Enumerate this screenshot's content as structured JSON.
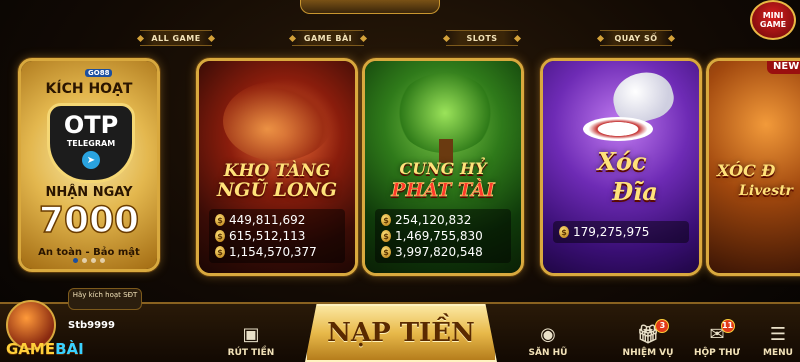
{
  "mini_game": {
    "label": "MINI GAME"
  },
  "categories": [
    "ALL GAME",
    "GAME BÀI",
    "SLOTS",
    "QUAY SỐ"
  ],
  "promo": {
    "brand": "GO88",
    "line1": "KÍCH HOẠT",
    "otp": "OTP",
    "telegram": "TELEGRAM",
    "line2": "NHẬN NGAY",
    "amount": "7000",
    "tagline": "An toàn - Bảo mật"
  },
  "games": [
    {
      "title_top": "KHO TÀNG",
      "title_bottom": "NGŨ LONG",
      "jackpots": [
        "449,811,692",
        "615,512,113",
        "1,154,570,377"
      ]
    },
    {
      "title_top": "CUNG HỶ",
      "title_bottom": "PHÁT TÀI",
      "jackpots": [
        "254,120,832",
        "1,469,755,830",
        "3,997,820,548"
      ]
    },
    {
      "title_top": "Xóc",
      "title_bottom": "Đĩa",
      "jackpots": [
        "179,275,975"
      ]
    },
    {
      "badge": "NEW",
      "title_top": "XÓC Đ",
      "title_bottom": "Livestr"
    }
  ],
  "user": {
    "hint": "Hãy kích hoạt SĐT",
    "username": "Stb9999",
    "brand_a": "GAME",
    "brand_b": "BÀI"
  },
  "nav": {
    "withdraw": "RÚT TIỀN",
    "deposit": "NẠP TIỀN",
    "jackpot_hall": "SĂN HŨ",
    "missions": "NHIỆM VỤ",
    "missions_badge": "3",
    "mailbox": "HỘP THƯ",
    "mailbox_badge": "11",
    "menu": "MENU"
  },
  "currency_symbol": "$"
}
